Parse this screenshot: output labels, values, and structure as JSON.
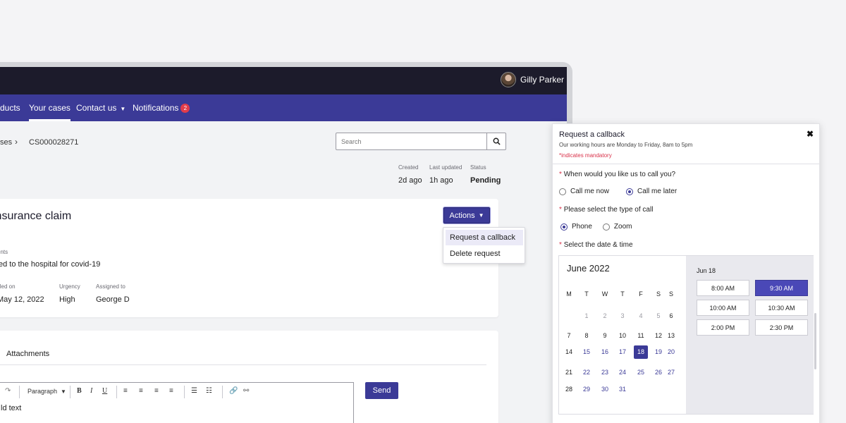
{
  "header": {
    "user_name": "Gilly Parker"
  },
  "nav": {
    "items": [
      "ducts",
      "Your cases",
      "Contact us",
      "Notifications"
    ],
    "notifications_count": "2"
  },
  "breadcrumb": {
    "parent": "ses",
    "current": "CS000028271"
  },
  "search": {
    "placeholder": "Search"
  },
  "case_meta": {
    "created_label": "Created",
    "created_value": "2d ago",
    "updated_label": "Last updated",
    "updated_value": "1h ago",
    "status_label": "Status",
    "status_value": "Pending"
  },
  "case": {
    "title": "insurance claim",
    "actions_label": "Actions",
    "menu": [
      "Request a callback",
      "Delete request"
    ],
    "comments_label": "ents",
    "comments_value": "ed to the hospital for covid-19",
    "filed_label": "iled on",
    "filed_value": "May 12, 2022",
    "urgency_label": "Urgency",
    "urgency_value": "High",
    "assigned_label": "Assigned to",
    "assigned_value": "George D"
  },
  "tabs": {
    "attachments": "Attachments"
  },
  "editor": {
    "format_select": "Paragraph",
    "text": "ld text",
    "send_label": "Send"
  },
  "callback": {
    "title": "Request a callback",
    "subtitle": "Our working hours are Monday to Friday, 8am to 5pm",
    "mandatory_note": "*indicates mandatory",
    "q1": "When would you like us to call you?",
    "q1_options": [
      "Call me now",
      "Call me later"
    ],
    "q2": "Please select the type of call",
    "q2_options": [
      "Phone",
      "Zoom"
    ],
    "q3": "Select the date & time",
    "month": "June 2022",
    "weekdays": [
      "M",
      "T",
      "W",
      "T",
      "F",
      "S",
      "S"
    ],
    "weeks": [
      [
        "",
        "1",
        "2",
        "3",
        "4",
        "5",
        "6"
      ],
      [
        "7",
        "8",
        "9",
        "10",
        "11",
        "12",
        "13"
      ],
      [
        "14",
        "15",
        "16",
        "17",
        "18",
        "19",
        "20"
      ],
      [
        "21",
        "22",
        "23",
        "24",
        "25",
        "26",
        "27"
      ],
      [
        "28",
        "29",
        "30",
        "31",
        "",
        "",
        ""
      ]
    ],
    "selected_date": "Jun 18",
    "time_slots": [
      "8:00 AM",
      "9:30 AM",
      "10:00 AM",
      "10:30 AM",
      "2:00 PM",
      "2:30 PM"
    ],
    "selected_time": "9:30 AM"
  },
  "colors": {
    "brand": "#3b3a97",
    "topbar": "#1c1b2b",
    "required": "#d9324a",
    "badge": "#e23c4a"
  },
  "icons": [
    "search-icon",
    "caret-down-icon",
    "close-icon",
    "chevron-right-icon",
    "redo-icon",
    "bold-icon",
    "italic-icon",
    "underline-icon",
    "align-left-icon",
    "align-center-icon",
    "align-right-icon",
    "justify-icon",
    "bullet-list-icon",
    "numbered-list-icon",
    "link-icon",
    "unlink-icon"
  ]
}
